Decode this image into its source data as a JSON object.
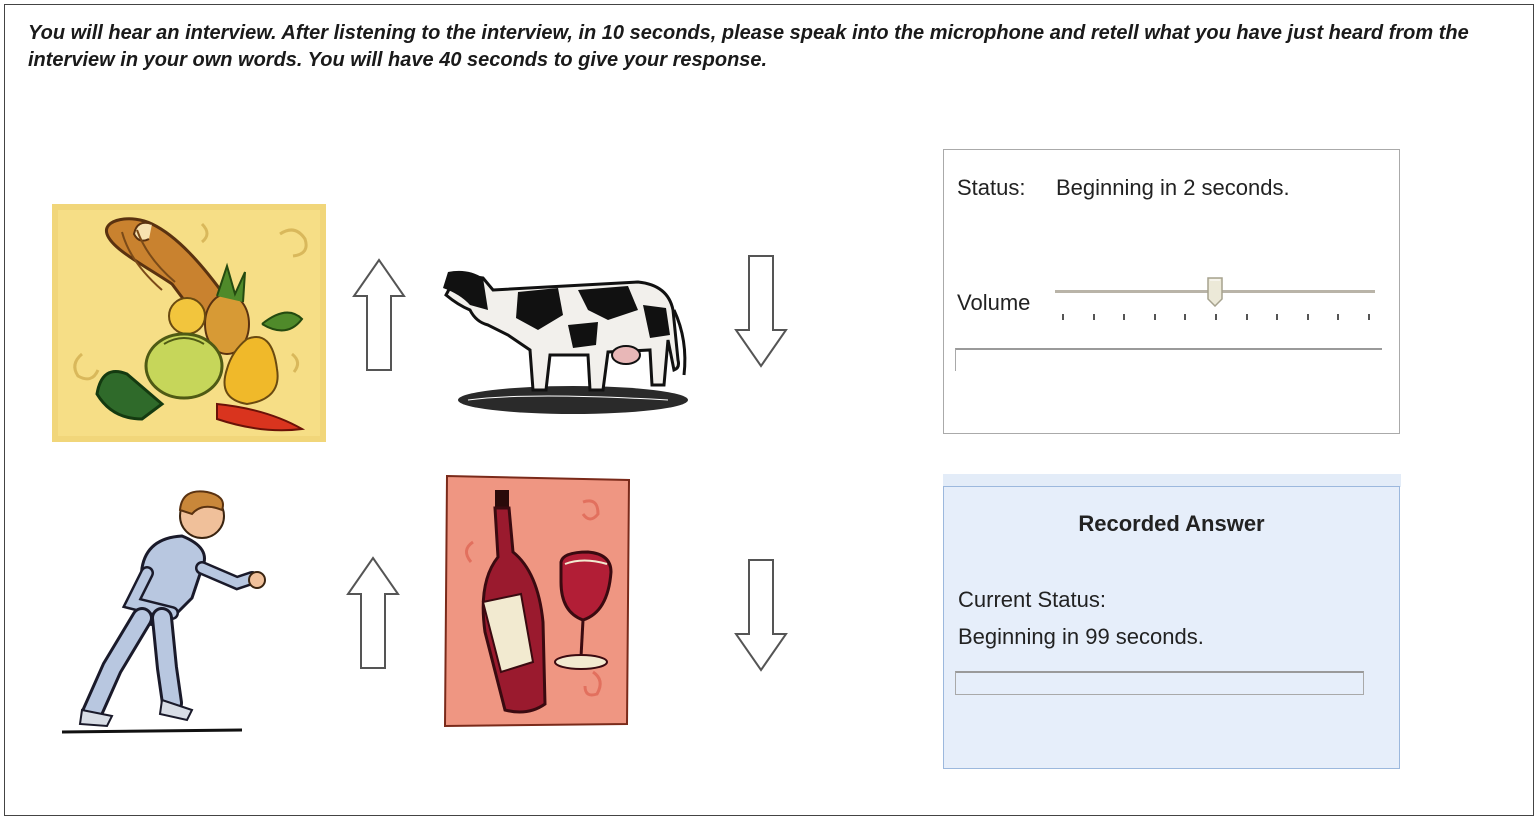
{
  "instructions": "You will hear an interview. After listening to the interview, in 10 seconds, please speak into the microphone and retell what you have just heard from the interview in your own words. You will have 40 seconds to give your response.",
  "images": [
    {
      "name": "cornucopia-image",
      "icon": "cornucopia"
    },
    {
      "name": "cow-image",
      "icon": "cow"
    },
    {
      "name": "runner-image",
      "icon": "running-man"
    },
    {
      "name": "wine-image",
      "icon": "wine-bottle-and-glass"
    }
  ],
  "arrows": [
    "arrow-up",
    "arrow-down",
    "arrow-up",
    "arrow-down"
  ],
  "status_panel": {
    "status_label": "Status:",
    "status_value": "Beginning in 2 seconds.",
    "volume_label": "Volume",
    "volume_level": 0.5
  },
  "recorded_answer": {
    "title": "Recorded Answer",
    "current_status_label": "Current Status:",
    "current_status_value": "Beginning in 99 seconds.",
    "progress": 0
  },
  "colors": {
    "panel_border": "#aaaaaa",
    "recorded_bg": "#e6eefa",
    "recorded_border": "#9cb8dd"
  }
}
